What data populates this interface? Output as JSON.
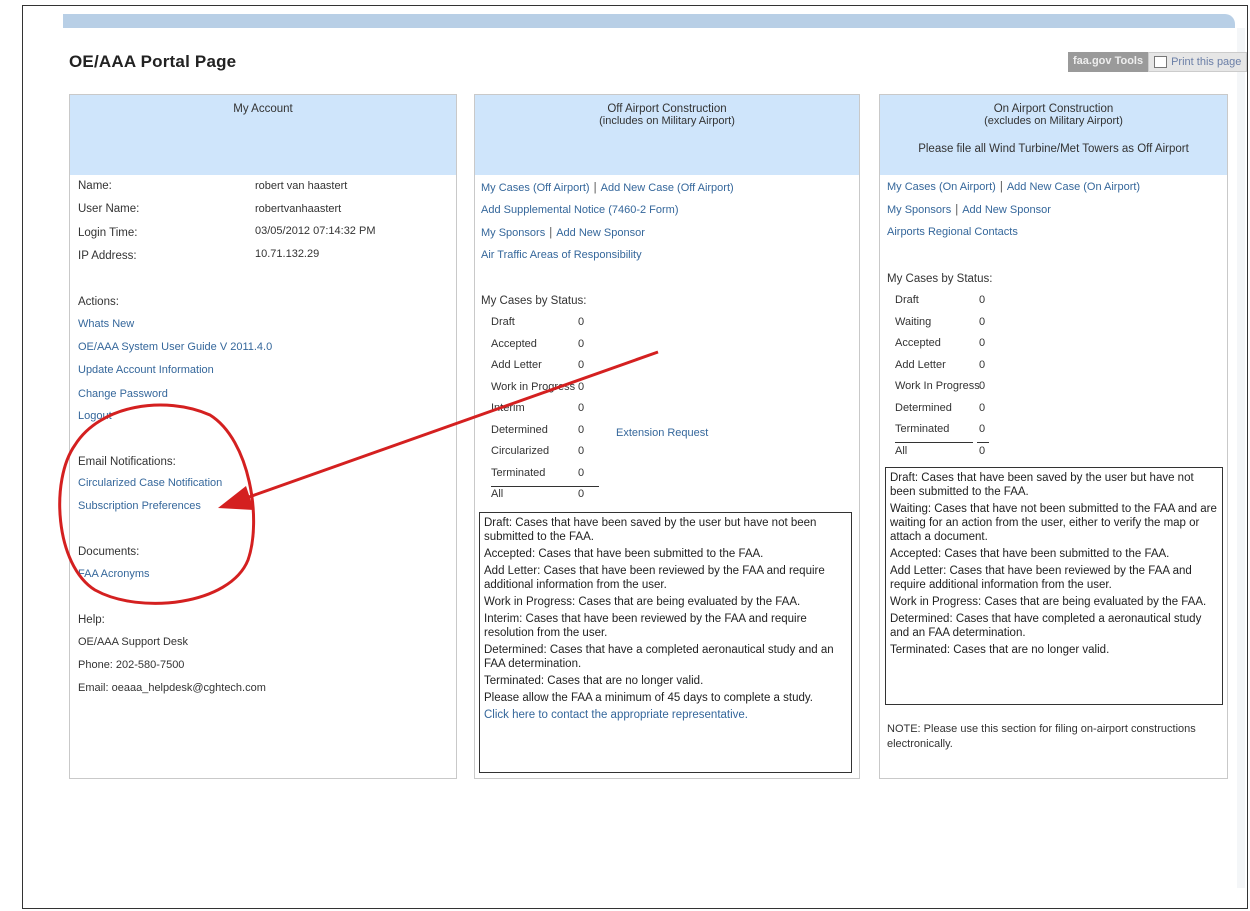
{
  "page_title": "OE/AAA Portal Page",
  "tools": {
    "faa_tools": "faa.gov Tools",
    "print": "Print this page"
  },
  "account": {
    "header": "My Account",
    "fields": [
      {
        "label": "Name:",
        "value": "robert van haastert"
      },
      {
        "label": "User Name:",
        "value": "robertvanhaastert"
      },
      {
        "label": "Login Time:",
        "value": "03/05/2012 07:14:32 PM"
      },
      {
        "label": "IP Address:",
        "value": "10.71.132.29"
      }
    ],
    "actions_label": "Actions:",
    "actions": [
      "Whats New",
      "OE/AAA System User Guide V 2011.4.0",
      "Update Account Information",
      "Change Password",
      "Logout"
    ],
    "email_label": "Email Notifications:",
    "email_links": [
      "Circularized Case Notification",
      "Subscription Preferences"
    ],
    "documents_label": "Documents:",
    "documents": [
      "FAA Acronyms"
    ],
    "help_label": "Help:",
    "help_lines": [
      "OE/AAA Support Desk",
      "Phone: 202-580-7500",
      "Email: oeaaa_helpdesk@cghtech.com"
    ]
  },
  "off_airport": {
    "header": "Off Airport Construction",
    "subheader": "(includes on Military Airport)",
    "link_rows": [
      [
        "My Cases (Off Airport)",
        "Add New Case (Off Airport)"
      ],
      [
        "Add Supplemental Notice (7460-2 Form)"
      ],
      [
        "My Sponsors",
        "Add New Sponsor"
      ],
      [
        "Air Traffic Areas of Responsibility"
      ]
    ],
    "status_label": "My Cases by Status:",
    "statuses": [
      {
        "name": "Draft",
        "count": "0"
      },
      {
        "name": "Accepted",
        "count": "0"
      },
      {
        "name": "Add Letter",
        "count": "0"
      },
      {
        "name": "Work in Progress",
        "count": "0"
      },
      {
        "name": "Interim",
        "count": "0"
      },
      {
        "name": "Determined",
        "count": "0"
      },
      {
        "name": "Circularized",
        "count": "0"
      },
      {
        "name": "Terminated",
        "count": "0"
      },
      {
        "name": "All",
        "count": "0"
      }
    ],
    "extension_link": "Extension Request",
    "definitions": [
      "Draft: Cases that have been saved by the user but have not been submitted to the FAA.",
      "Accepted: Cases that have been submitted to the FAA.",
      "Add Letter: Cases that have been reviewed by the FAA and require additional information from the user.",
      "Work in Progress: Cases that are being evaluated by the FAA.",
      "Interim: Cases that have been reviewed by the FAA and require resolution from the user.",
      "Determined: Cases that have a completed aeronautical study and an FAA determination.",
      "Terminated: Cases that are no longer valid.",
      "Please allow the FAA a minimum of 45 days to complete a study."
    ],
    "contact_link": "Click here to contact the appropriate representative."
  },
  "on_airport": {
    "header": "On Airport Construction",
    "subheader": "(excludes on Military Airport)",
    "note": "Please file all Wind Turbine/Met Towers as Off Airport",
    "link_rows": [
      [
        "My Cases (On Airport)",
        "Add New Case (On Airport)"
      ],
      [
        "My Sponsors",
        "Add New Sponsor"
      ],
      [
        "Airports Regional Contacts"
      ]
    ],
    "status_label": "My Cases by Status:",
    "statuses": [
      {
        "name": "Draft",
        "count": "0"
      },
      {
        "name": "Waiting",
        "count": "0"
      },
      {
        "name": "Accepted",
        "count": "0"
      },
      {
        "name": "Add Letter",
        "count": "0"
      },
      {
        "name": "Work In Progress",
        "count": "0"
      },
      {
        "name": "Determined",
        "count": "0"
      },
      {
        "name": "Terminated",
        "count": "0"
      },
      {
        "name": "All",
        "count": "0"
      }
    ],
    "definitions": [
      "Draft: Cases that have been saved by the user but have not been submitted to the FAA.",
      "Waiting: Cases that have not been submitted to the FAA and are waiting for an action from the user, either to verify the map or attach a document.",
      "Accepted: Cases that have been submitted to the FAA.",
      "Add Letter: Cases that have been reviewed by the FAA and require additional information from the user.",
      "Work in Progress: Cases that are being evaluated by the FAA.",
      "Determined: Cases that have completed a aeronautical study and an FAA determination.",
      "Terminated: Cases that are no longer valid."
    ],
    "footnote": "NOTE: Please use this section for filing on-airport constructions electronically."
  },
  "colors": {
    "panel_header": "#cfe5fb",
    "link": "#35679b",
    "annotation": "#d42020"
  }
}
